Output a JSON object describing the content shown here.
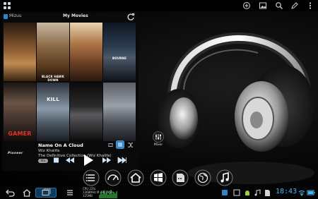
{
  "status_bar": {
    "icons": [
      "apps-grid-icon",
      "add-circle-icon",
      "gallery-icon",
      "search-icon",
      "edit-icon",
      "overflow-menu-icon"
    ]
  },
  "widget": {
    "app_name": "Mizuu",
    "title": "My Movies",
    "covers": [
      {
        "name": "movie-cover-1",
        "caption": "",
        "bg": "#6a4a2a"
      },
      {
        "name": "movie-cover-2",
        "caption": "BLACK HAWK DOWN",
        "bg": "#7a5a3a"
      },
      {
        "name": "movie-cover-3",
        "caption": "",
        "bg": "#9a6c4a"
      },
      {
        "name": "movie-cover-4",
        "caption": "BOURNE",
        "bg": "#1e2a38"
      },
      {
        "name": "movie-cover-5",
        "caption": "GAMER",
        "bg": "#3a2b26"
      },
      {
        "name": "movie-cover-6",
        "caption": "KILL",
        "bg": "#3a4450"
      },
      {
        "name": "movie-cover-7",
        "caption": "",
        "bg": "#1a1a1c"
      },
      {
        "name": "movie-cover-8",
        "caption": "",
        "bg": "#4a4e55"
      }
    ],
    "now_playing": {
      "song": "Name On A Cloud",
      "artist": "Wiz Khalifa",
      "album": "The Definitive Collection (Wiz Khalifa)",
      "badge": "Wiz"
    },
    "brand": "Pioneer"
  },
  "dock": {
    "label_mixer": "Mixer"
  },
  "bottom_bar": {
    "cpu_lines": [
      "CPU 22%",
      "1368MHz M 4822MHz",
      "125MB"
    ],
    "clock": "18:43"
  },
  "colors": {
    "accent": "#49b7f0",
    "widget_bg": "#0a0a0c"
  }
}
